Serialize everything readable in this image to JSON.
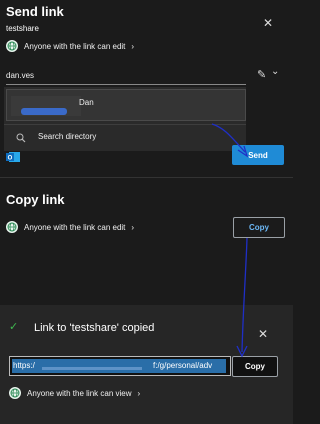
{
  "send": {
    "title": "Send link",
    "subtitle": "testshare",
    "permission": "Anyone with the link can edit",
    "chevron": "›",
    "recipient": "dan.ves",
    "suggestion_name": "Dan",
    "search_directory": "Search directory",
    "send_button": "Send"
  },
  "copy": {
    "title": "Copy link",
    "permission": "Anyone with the link can edit",
    "chevron": "›",
    "copy_button": "Copy"
  },
  "toast": {
    "message": "Link to 'testshare' copied",
    "url_start": "https:/",
    "url_end": "f:/g/personal/adv",
    "copy_button": "Copy",
    "permission": "Anyone with the link can view",
    "chevron": "›"
  },
  "icons": {
    "close": "✕",
    "check": "✓",
    "pencil": "✎",
    "chevron_down": "⌄"
  },
  "colors": {
    "accent": "#1f8bd6",
    "annotation": "#1f2fc7"
  }
}
